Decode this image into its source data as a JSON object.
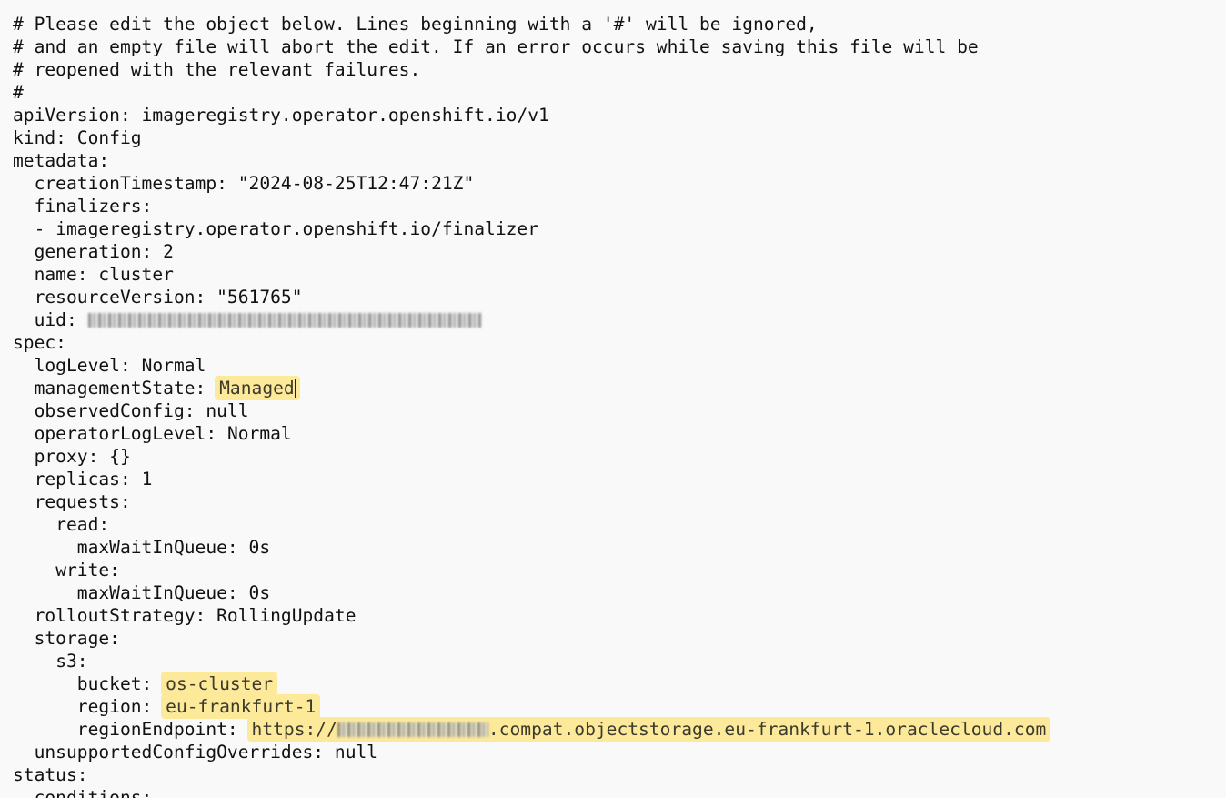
{
  "editor": {
    "highlight_color": "#fde99a",
    "lines": [
      {
        "indent": "",
        "text": "# Please edit the object below. Lines beginning with a '#' will be ignored,"
      },
      {
        "indent": "",
        "text": "# and an empty file will abort the edit. If an error occurs while saving this file will be"
      },
      {
        "indent": "",
        "text": "# reopened with the relevant failures."
      },
      {
        "indent": "",
        "text": "#"
      },
      {
        "indent": "",
        "key": "apiVersion:",
        "value": "imageregistry.operator.openshift.io/v1"
      },
      {
        "indent": "",
        "key": "kind:",
        "value": "Config"
      },
      {
        "indent": "",
        "key": "metadata:"
      },
      {
        "indent": "  ",
        "key": "creationTimestamp:",
        "value": "\"2024-08-25T12:47:21Z\""
      },
      {
        "indent": "  ",
        "key": "finalizers:"
      },
      {
        "indent": "  ",
        "key": "-",
        "value": "imageregistry.operator.openshift.io/finalizer"
      },
      {
        "indent": "  ",
        "key": "generation:",
        "value": "2"
      },
      {
        "indent": "  ",
        "key": "name:",
        "value": "cluster"
      },
      {
        "indent": "  ",
        "key": "resourceVersion:",
        "value": "\"561765\""
      },
      {
        "indent": "  ",
        "key": "uid:",
        "redacted": true
      },
      {
        "indent": "",
        "key": "spec:"
      },
      {
        "indent": "  ",
        "key": "logLevel:",
        "value": "Normal"
      },
      {
        "indent": "  ",
        "key": "managementState:",
        "value": "Managed",
        "highlight": true,
        "cursor": true
      },
      {
        "indent": "  ",
        "key": "observedConfig:",
        "value": "null"
      },
      {
        "indent": "  ",
        "key": "operatorLogLevel:",
        "value": "Normal"
      },
      {
        "indent": "  ",
        "key": "proxy:",
        "value": "{}"
      },
      {
        "indent": "  ",
        "key": "replicas:",
        "value": "1"
      },
      {
        "indent": "  ",
        "key": "requests:"
      },
      {
        "indent": "    ",
        "key": "read:"
      },
      {
        "indent": "      ",
        "key": "maxWaitInQueue:",
        "value": "0s"
      },
      {
        "indent": "    ",
        "key": "write:"
      },
      {
        "indent": "      ",
        "key": "maxWaitInQueue:",
        "value": "0s"
      },
      {
        "indent": "  ",
        "key": "rolloutStrategy:",
        "value": "RollingUpdate"
      },
      {
        "indent": "  ",
        "key": "storage:"
      },
      {
        "indent": "    ",
        "key": "s3:"
      },
      {
        "indent": "      ",
        "key": "bucket:",
        "value": "os-cluster",
        "highlight": true
      },
      {
        "indent": "      ",
        "key": "region:",
        "value": "eu-frankfurt-1",
        "highlight": true
      },
      {
        "indent": "      ",
        "key": "regionEndpoint:",
        "value_prefix": "https://",
        "value": ".compat.objectstorage.eu-frankfurt-1.oraclecloud.com",
        "highlight": true,
        "redacted_mid": true
      },
      {
        "indent": "  ",
        "key": "unsupportedConfigOverrides:",
        "value": "null"
      },
      {
        "indent": "",
        "key": "status:"
      },
      {
        "indent": "  ",
        "key": "conditions:"
      }
    ]
  }
}
